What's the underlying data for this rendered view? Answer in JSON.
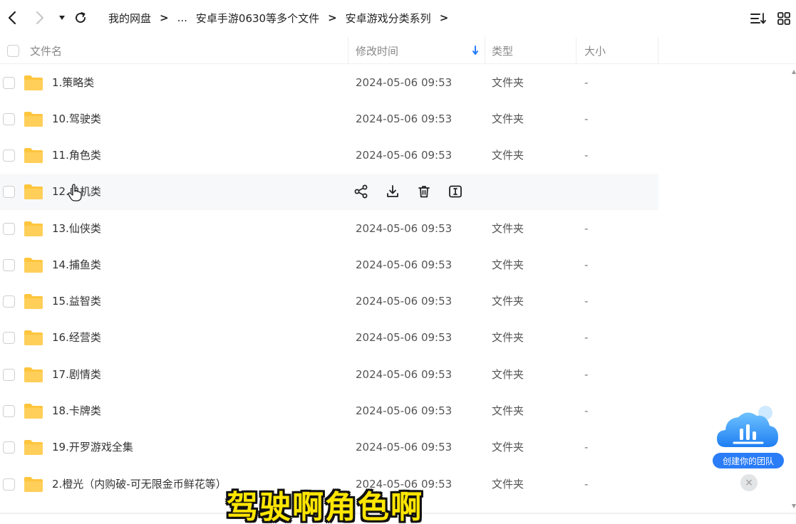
{
  "breadcrumb": {
    "items": [
      "我的网盘",
      "...",
      "安卓手游0630等多个文件",
      "安卓游戏分类系列"
    ]
  },
  "header": {
    "name": "文件名",
    "modified": "修改时间",
    "type": "类型",
    "size": "大小"
  },
  "rows": [
    {
      "name": "1.策略类",
      "date": "2024-05-06 09:53",
      "type": "文件夹",
      "size": "-"
    },
    {
      "name": "10.驾驶类",
      "date": "2024-05-06 09:53",
      "type": "文件夹",
      "size": "-"
    },
    {
      "name": "11.角色类",
      "date": "2024-05-06 09:53",
      "type": "文件夹",
      "size": "-"
    },
    {
      "name": "12.单机类",
      "date": "",
      "type": "",
      "size": ""
    },
    {
      "name": "13.仙侠类",
      "date": "2024-05-06 09:53",
      "type": "文件夹",
      "size": "-"
    },
    {
      "name": "14.捕鱼类",
      "date": "2024-05-06 09:53",
      "type": "文件夹",
      "size": "-"
    },
    {
      "name": "15.益智类",
      "date": "2024-05-06 09:53",
      "type": "文件夹",
      "size": "-"
    },
    {
      "name": "16.经营类",
      "date": "2024-05-06 09:53",
      "type": "文件夹",
      "size": "-"
    },
    {
      "name": "17.剧情类",
      "date": "2024-05-06 09:53",
      "type": "文件夹",
      "size": "-"
    },
    {
      "name": "18.卡牌类",
      "date": "2024-05-06 09:53",
      "type": "文件夹",
      "size": "-"
    },
    {
      "name": "19.开罗游戏全集",
      "date": "2024-05-06 09:53",
      "type": "文件夹",
      "size": "-"
    },
    {
      "name": "2.橙光（内购破-可无限金币鲜花等）",
      "date": "2024-05-06 09:53",
      "type": "文件夹",
      "size": "-"
    }
  ],
  "team_widget": {
    "label": "创建你的团队",
    "close": "×"
  },
  "subtitle": "驾驶啊角色啊",
  "colors": {
    "accent": "#2a7cf7",
    "folder": "#ffc53d",
    "subtitle": "#ffe600"
  },
  "icons": {
    "back": "chevron-left-icon",
    "forward": "chevron-right-icon",
    "history": "caret-down-icon",
    "refresh": "refresh-icon",
    "sort": "sort-icon",
    "grid": "grid-view-icon",
    "share": "share-icon",
    "download": "download-icon",
    "delete": "trash-icon",
    "rename": "rename-icon"
  }
}
